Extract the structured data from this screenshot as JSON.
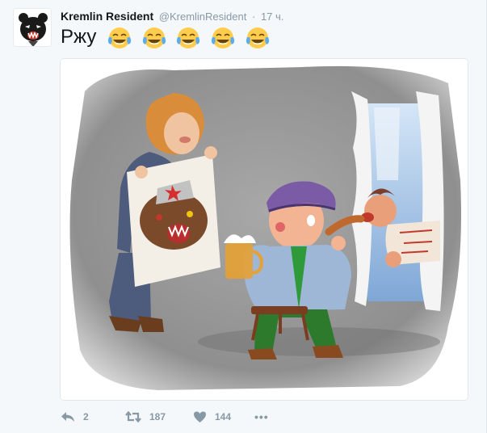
{
  "tweet": {
    "author_name": "Kremlin Resident",
    "author_handle": "@KremlinResident",
    "separator": "·",
    "timestamp": "17 ч.",
    "text": "Ржу",
    "emoji_icons": [
      "face-with-tears-of-joy-icon",
      "face-with-tears-of-joy-icon",
      "face-with-tears-of-joy-icon",
      "face-with-tears-of-joy-icon",
      "face-with-tears-of-joy-icon"
    ],
    "media_icon": "caricature-illustration"
  },
  "actions": {
    "reply_count": "2",
    "retweet_count": "187",
    "like_count": "144",
    "more_label": "•••"
  },
  "colors": {
    "background": "#f5f8fa",
    "name": "#14171a",
    "muted": "#8899a6",
    "border": "#e1e8ed"
  }
}
